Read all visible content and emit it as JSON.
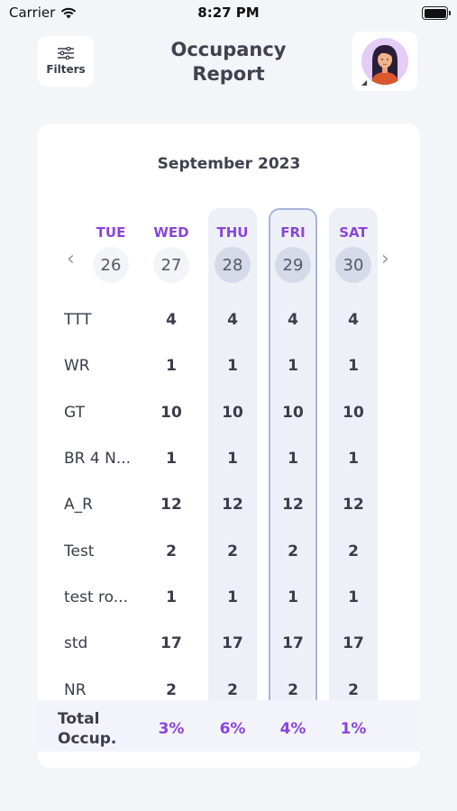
{
  "status_bar": {
    "carrier": "Carrier",
    "time": "8:27 PM"
  },
  "header": {
    "filters_label": "Filters",
    "title": "Occupancy Report"
  },
  "calendar": {
    "month": "September 2023",
    "days": [
      {
        "name": "TUE",
        "num": "26",
        "selected": false
      },
      {
        "name": "WED",
        "num": "27",
        "selected": false
      },
      {
        "name": "THU",
        "num": "28",
        "selected": true
      },
      {
        "name": "FRI",
        "num": "29",
        "selected": true
      },
      {
        "name": "SAT",
        "num": "30",
        "selected": true
      }
    ]
  },
  "rows": [
    {
      "label": "TTT",
      "values": [
        "4",
        "4",
        "4",
        "4"
      ]
    },
    {
      "label": "WR",
      "values": [
        "1",
        "1",
        "1",
        "1"
      ]
    },
    {
      "label": "GT",
      "values": [
        "10",
        "10",
        "10",
        "10"
      ]
    },
    {
      "label": "BR 4 N...",
      "values": [
        "1",
        "1",
        "1",
        "1"
      ]
    },
    {
      "label": "A_R",
      "values": [
        "12",
        "12",
        "12",
        "12"
      ]
    },
    {
      "label": "Test",
      "values": [
        "2",
        "2",
        "2",
        "2"
      ]
    },
    {
      "label": "test ro...",
      "values": [
        "1",
        "1",
        "1",
        "1"
      ]
    },
    {
      "label": "std",
      "values": [
        "17",
        "17",
        "17",
        "17"
      ]
    },
    {
      "label": "NR",
      "values": [
        "2",
        "2",
        "2",
        "2"
      ]
    }
  ],
  "footer": {
    "label_line1": "Total",
    "label_line2": "Occup.",
    "values": [
      "3%",
      "6%",
      "4%",
      "1%"
    ]
  },
  "colors": {
    "accent": "#8a45dd",
    "background": "#f4f5f9",
    "selected_border": "#a9b3dd"
  }
}
